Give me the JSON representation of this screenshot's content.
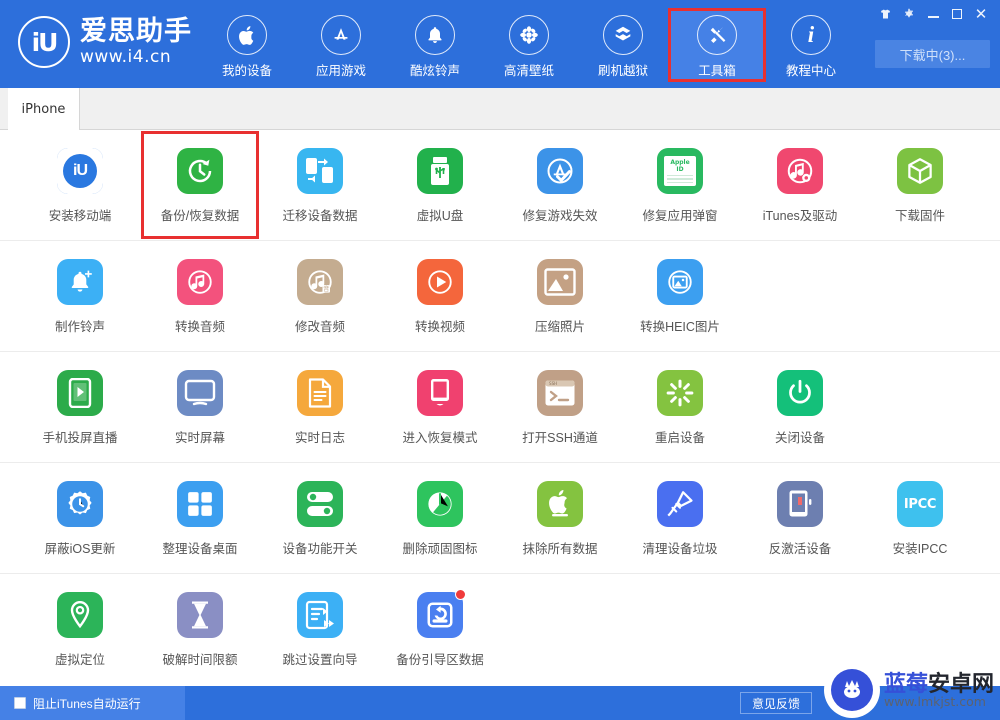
{
  "window": {
    "brand_cn": "爱思助手",
    "brand_url": "www.i4.cn",
    "logo_mark": "iU",
    "controls": [
      {
        "name": "skin",
        "glyph": "👕"
      },
      {
        "name": "settings",
        "glyph": "⚙"
      },
      {
        "name": "minimize",
        "glyph": "—"
      },
      {
        "name": "maximize",
        "glyph": "▢"
      },
      {
        "name": "close",
        "glyph": "✕"
      }
    ],
    "download_button": "下载中(3)..."
  },
  "nav": {
    "items": [
      {
        "label": "我的设备",
        "icon": "apple-icon",
        "glyph": "",
        "active": false,
        "boxed": false
      },
      {
        "label": "应用游戏",
        "icon": "appstore-icon",
        "glyph": "Ⓐ",
        "active": false,
        "boxed": false
      },
      {
        "label": "酷炫铃声",
        "icon": "bell-icon",
        "glyph": "🔔",
        "active": false,
        "boxed": false
      },
      {
        "label": "高清壁纸",
        "icon": "flower-icon",
        "glyph": "✿",
        "active": false,
        "boxed": false
      },
      {
        "label": "刷机越狱",
        "icon": "box-open-icon",
        "glyph": "📦",
        "active": false,
        "boxed": false
      },
      {
        "label": "工具箱",
        "icon": "tools-icon",
        "glyph": "⚒",
        "active": true,
        "boxed": true
      },
      {
        "label": "教程中心",
        "icon": "info-icon",
        "glyph": "i",
        "active": false,
        "boxed": false
      }
    ]
  },
  "tabs": [
    {
      "label": "iPhone",
      "active": true
    }
  ],
  "tool_rows": [
    {
      "tools": [
        {
          "label": "安装移动端",
          "icon": "i4-app-icon",
          "bg": "#2a78e0",
          "glyph": "iU",
          "boxed": false,
          "dot": false
        },
        {
          "label": "备份/恢复数据",
          "icon": "backup-restore-icon",
          "bg": "#2fb344",
          "glyph": "↺",
          "boxed": true,
          "dot": false
        },
        {
          "label": "迁移设备数据",
          "icon": "migrate-data-icon",
          "bg": "#38b6f0",
          "glyph": "⇄",
          "boxed": false,
          "dot": false
        },
        {
          "label": "虚拟U盘",
          "icon": "usb-drive-icon",
          "bg": "#22b14c",
          "glyph": "⌷",
          "boxed": false,
          "dot": false
        },
        {
          "label": "修复游戏失效",
          "icon": "fix-game-icon",
          "bg": "#3c93e8",
          "glyph": "Ⓐ",
          "boxed": false,
          "dot": false
        },
        {
          "label": "修复应用弹窗",
          "icon": "apple-id-popup-icon",
          "bg": "#29b960",
          "glyph": "▤",
          "boxed": false,
          "dot": false
        },
        {
          "label": "iTunes及驱动",
          "icon": "itunes-driver-icon",
          "bg": "#f0486f",
          "glyph": "♫",
          "boxed": false,
          "dot": false
        },
        {
          "label": "下载固件",
          "icon": "firmware-download-icon",
          "bg": "#7dc242",
          "glyph": "⬡",
          "boxed": false,
          "dot": false
        }
      ]
    },
    {
      "tools": [
        {
          "label": "制作铃声",
          "icon": "make-ringtone-icon",
          "bg": "#3cb0f5",
          "glyph": "🔔",
          "boxed": false,
          "dot": false
        },
        {
          "label": "转换音频",
          "icon": "convert-audio-icon",
          "bg": "#f3527d",
          "glyph": "♫",
          "boxed": false,
          "dot": false
        },
        {
          "label": "修改音频",
          "icon": "edit-audio-icon",
          "bg": "#c4ac90",
          "glyph": "♫",
          "boxed": false,
          "dot": false
        },
        {
          "label": "转换视频",
          "icon": "convert-video-icon",
          "bg": "#f4663c",
          "glyph": "▶",
          "boxed": false,
          "dot": false
        },
        {
          "label": "压缩照片",
          "icon": "compress-photo-icon",
          "bg": "#c4a184",
          "glyph": "🖼",
          "boxed": false,
          "dot": false
        },
        {
          "label": "转换HEIC图片",
          "icon": "convert-heic-icon",
          "bg": "#3c9ff0",
          "glyph": "🖼",
          "boxed": false,
          "dot": false
        }
      ]
    },
    {
      "tools": [
        {
          "label": "手机投屏直播",
          "icon": "screen-cast-icon",
          "bg": "#2cab4a",
          "glyph": "▶",
          "boxed": false,
          "dot": false
        },
        {
          "label": "实时屏幕",
          "icon": "live-screen-icon",
          "bg": "#6d8bc4",
          "glyph": "🖵",
          "boxed": false,
          "dot": false
        },
        {
          "label": "实时日志",
          "icon": "live-log-icon",
          "bg": "#f5a83c",
          "glyph": "▤",
          "boxed": false,
          "dot": false
        },
        {
          "label": "进入恢复模式",
          "icon": "recovery-mode-icon",
          "bg": "#f0416f",
          "glyph": "▯",
          "boxed": false,
          "dot": false
        },
        {
          "label": "打开SSH通道",
          "icon": "ssh-tunnel-icon",
          "bg": "#c0a087",
          "glyph": ">_",
          "boxed": false,
          "dot": false
        },
        {
          "label": "重启设备",
          "icon": "reboot-device-icon",
          "bg": "#84c340",
          "glyph": "✳",
          "boxed": false,
          "dot": false
        },
        {
          "label": "关闭设备",
          "icon": "shutdown-device-icon",
          "bg": "#14c07a",
          "glyph": "⏻",
          "boxed": false,
          "dot": false
        }
      ]
    },
    {
      "tools": [
        {
          "label": "屏蔽iOS更新",
          "icon": "block-ios-update-icon",
          "bg": "#3c93e8",
          "glyph": "⚙",
          "boxed": false,
          "dot": false
        },
        {
          "label": "整理设备桌面",
          "icon": "organize-desktop-icon",
          "bg": "#3c9ff0",
          "glyph": "▦",
          "boxed": false,
          "dot": false
        },
        {
          "label": "设备功能开关",
          "icon": "feature-toggle-icon",
          "bg": "#2cb459",
          "glyph": "⊜",
          "boxed": false,
          "dot": false
        },
        {
          "label": "删除顽固图标",
          "icon": "delete-icon-icon",
          "bg": "#2ec45e",
          "glyph": "◔",
          "boxed": false,
          "dot": false
        },
        {
          "label": "抹除所有数据",
          "icon": "erase-all-data-icon",
          "bg": "#84c340",
          "glyph": "",
          "boxed": false,
          "dot": false
        },
        {
          "label": "清理设备垃圾",
          "icon": "clean-junk-icon",
          "bg": "#4a6ff0",
          "glyph": "🧹",
          "boxed": false,
          "dot": false
        },
        {
          "label": "反激活设备",
          "icon": "deactivate-device-icon",
          "bg": "#6d7fb0",
          "glyph": "▯",
          "boxed": false,
          "dot": false
        },
        {
          "label": "安装IPCC",
          "icon": "install-ipcc-icon",
          "bg": "#3ec1ee",
          "glyph": "IPCC",
          "boxed": false,
          "dot": false
        }
      ]
    },
    {
      "tools": [
        {
          "label": "虚拟定位",
          "icon": "virtual-location-icon",
          "bg": "#2cb459",
          "glyph": "◎",
          "boxed": false,
          "dot": false
        },
        {
          "label": "破解时间限额",
          "icon": "crack-time-limit-icon",
          "bg": "#8a8fc4",
          "glyph": "⧗",
          "boxed": false,
          "dot": false
        },
        {
          "label": "跳过设置向导",
          "icon": "skip-setup-icon",
          "bg": "#3cb0f5",
          "glyph": "⇥",
          "boxed": false,
          "dot": false
        },
        {
          "label": "备份引导区数据",
          "icon": "backup-boot-data-icon",
          "bg": "#4a7ff0",
          "glyph": "↩",
          "boxed": false,
          "dot": true
        }
      ]
    }
  ],
  "footer": {
    "checkbox_label": "阻止iTunes自动运行",
    "feedback_button": "意见反馈"
  },
  "watermark": {
    "cn_blue": "蓝莓",
    "cn_dark": "安卓网",
    "url": "www.lmkjst.com"
  },
  "colors": {
    "header_blue": "#2d6fdb",
    "active_blue": "#4581e6",
    "highlight_red": "#e83030"
  }
}
